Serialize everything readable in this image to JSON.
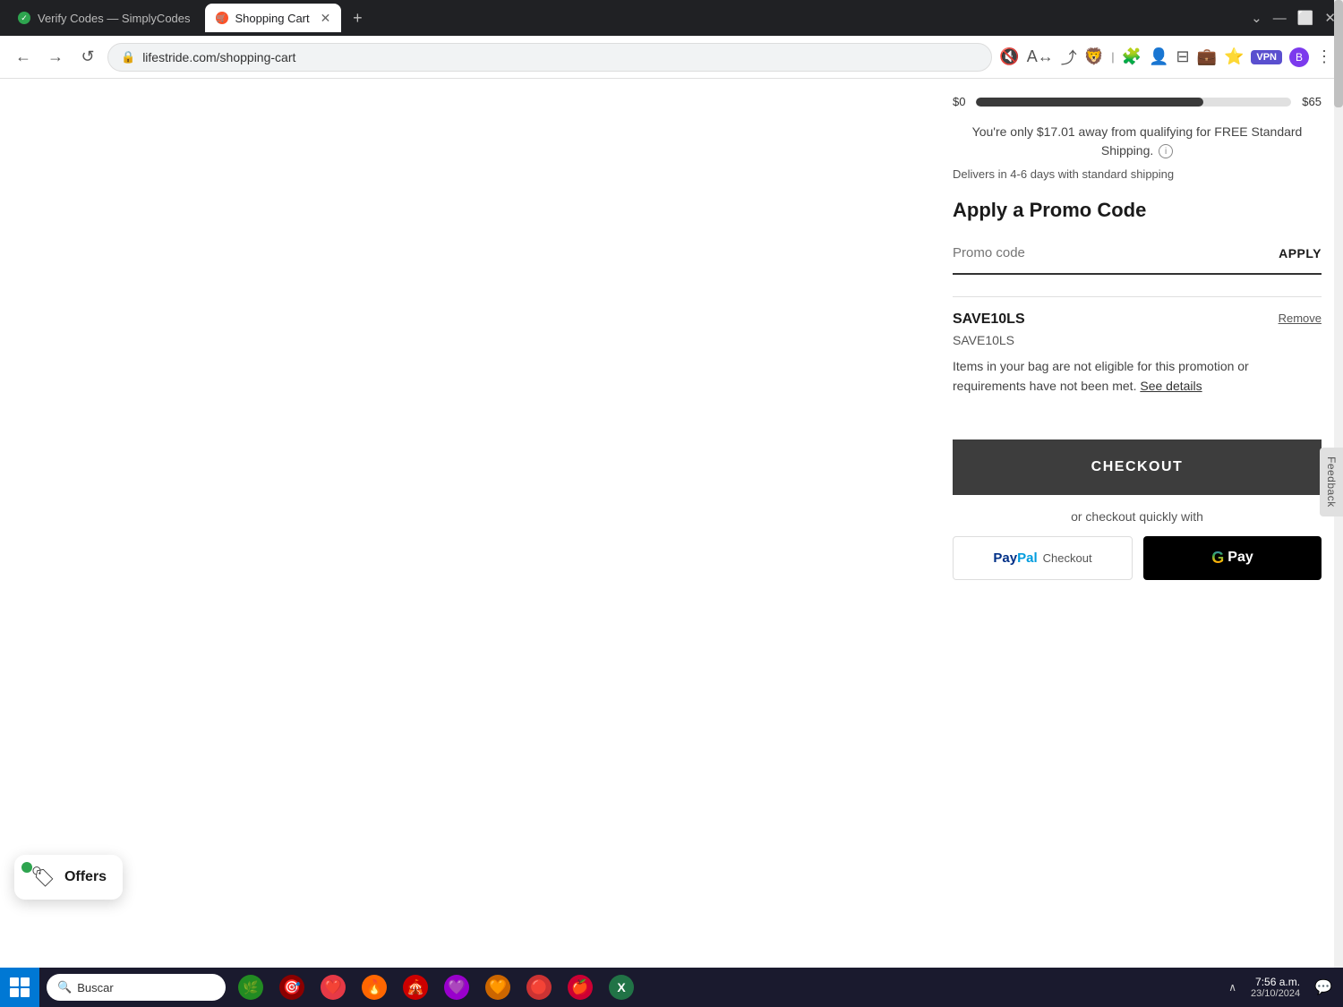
{
  "browser": {
    "tabs": [
      {
        "id": "tab-verify",
        "label": "Verify Codes — SimplyCodes",
        "active": false,
        "icon": "🟢"
      },
      {
        "id": "tab-cart",
        "label": "Shopping Cart",
        "active": true,
        "icon": "🛒"
      }
    ],
    "url": "lifestride.com/shopping-cart",
    "new_tab_label": "+",
    "nav_buttons": {
      "back": "←",
      "forward": "→",
      "reload": "↺"
    }
  },
  "page": {
    "progress": {
      "left_label": "$0",
      "right_label": "$65",
      "fill_percent": 72,
      "qualify_text": "You're only $17.01 away from qualifying for FREE Standard Shipping.",
      "delivery_text": "Delivers in 4-6 days with standard shipping"
    },
    "promo": {
      "title": "Apply a Promo Code",
      "input_placeholder": "Promo code",
      "apply_label": "APPLY"
    },
    "applied_code": {
      "code": "SAVE10LS",
      "subtitle": "SAVE10LS",
      "remove_label": "Remove",
      "message": "Items in your bag are not eligible for this promotion or requirements have not been met.",
      "see_details_label": "See details"
    },
    "checkout": {
      "button_label": "CHECKOUT",
      "or_text": "or checkout quickly with",
      "paypal_label": "PayPal",
      "paypal_checkout_label": "Checkout",
      "gpay_label": "Pay"
    },
    "feedback": {
      "label": "Feedback"
    },
    "offers": {
      "label": "Offers"
    }
  },
  "taskbar": {
    "search_placeholder": "Buscar",
    "time": "7:56 a.m.",
    "date": "23/10/2024"
  }
}
